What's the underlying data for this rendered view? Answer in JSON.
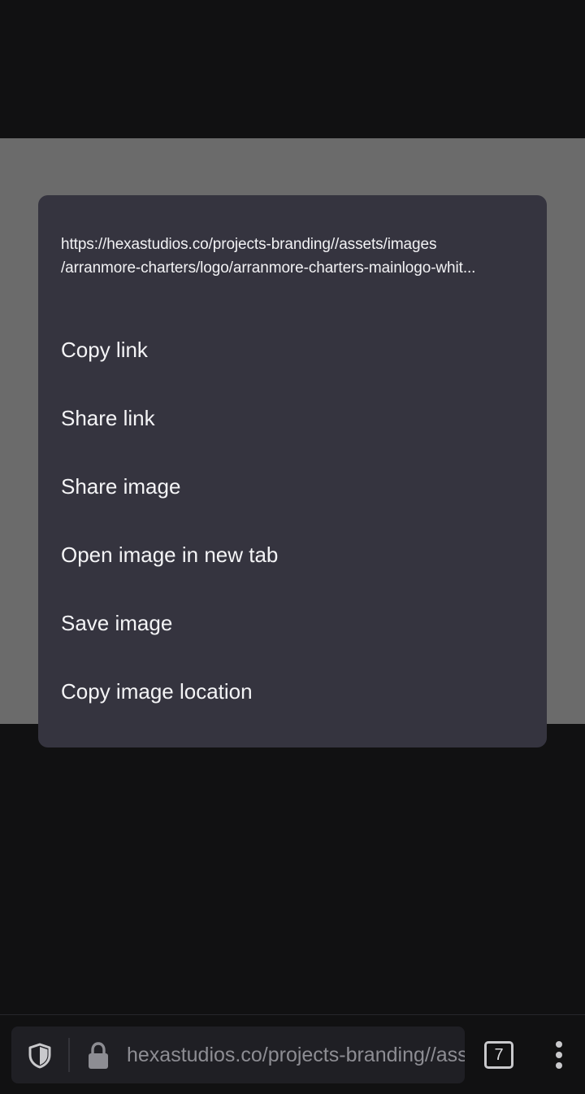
{
  "dialog": {
    "url_line1": "https://hexastudios.co/projects-branding//assets/images",
    "url_line2": "/arranmore-charters/logo/arranmore-charters-mainlogo-whit...",
    "items": [
      {
        "label": "Copy link"
      },
      {
        "label": "Share link"
      },
      {
        "label": "Share image"
      },
      {
        "label": "Open image in new tab"
      },
      {
        "label": "Save image"
      },
      {
        "label": "Copy image location"
      }
    ]
  },
  "toolbar": {
    "url_display": "hexastudios.co/projects-branding//assets/images",
    "tab_count": "7",
    "icons": {
      "shield": "shield-icon",
      "lock": "lock-icon",
      "tabs": "tabs-counter",
      "menu": "more-vert-icon"
    }
  },
  "colors": {
    "dialog_bg": "#35343f",
    "scrim_page": "#6b6b6b",
    "background": "#111112"
  }
}
